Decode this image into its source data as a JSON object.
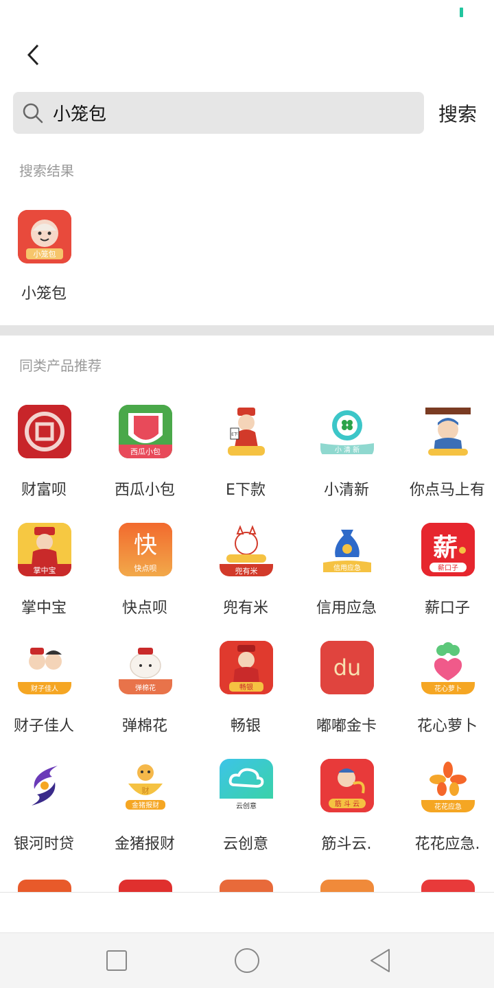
{
  "search": {
    "query": "小笼包",
    "button_label": "搜索"
  },
  "results": {
    "title": "搜索结果",
    "items": [
      {
        "name": "小笼包"
      }
    ]
  },
  "recommend": {
    "title": "同类产品推荐",
    "items": [
      {
        "name": "财富呗"
      },
      {
        "name": "西瓜小包"
      },
      {
        "name": "E下款"
      },
      {
        "name": "小清新"
      },
      {
        "name": "你点马上有"
      },
      {
        "name": "掌中宝"
      },
      {
        "name": "快点呗"
      },
      {
        "name": "兜有米"
      },
      {
        "name": "信用应急"
      },
      {
        "name": "薪口子"
      },
      {
        "name": "财子佳人"
      },
      {
        "name": "弹棉花"
      },
      {
        "name": "畅银"
      },
      {
        "name": "嘟嘟金卡"
      },
      {
        "name": "花心萝卜"
      },
      {
        "name": "银河时贷"
      },
      {
        "name": "金猪报财"
      },
      {
        "name": "云创意"
      },
      {
        "name": "筋斗云."
      },
      {
        "name": "花花应急."
      }
    ]
  },
  "icon_labels": {
    "xiaolongbao": "小笼包",
    "xigua": "西瓜小包",
    "xiaoqingxin": "小 清 新",
    "zhangzhongbao": "掌中宝",
    "kuai_char": "快",
    "kuaidianbei": "快点呗",
    "douyoumi": "兜有米",
    "xinyong": "信用应急",
    "xin_char": "薪",
    "xinkouzi": "薪口子",
    "caizi": "财子佳人",
    "tanmianhua": "弹棉花",
    "changyin": "畅银",
    "du": "du",
    "huaxin": "花心萝卜",
    "jinzhu": "金猪报财",
    "yunchuangyi": "云创意",
    "jindouyun": "筋 斗 云",
    "huahua": "花花应急",
    "cai": "财",
    "e_sign": "E下"
  },
  "colors": {
    "accent_teal": "#22c59e",
    "divider": "#e4e4e4",
    "search_bg": "#e6e6e6"
  }
}
